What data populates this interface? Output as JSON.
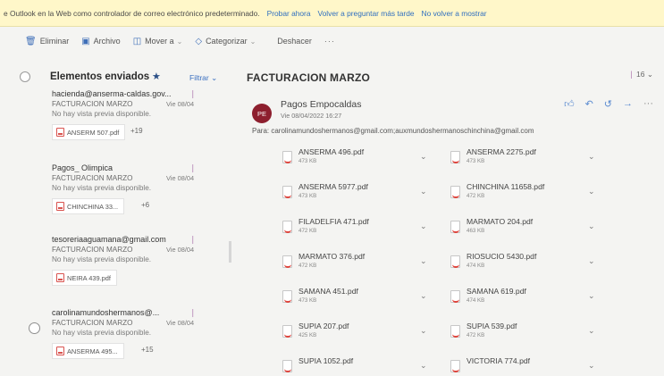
{
  "banner": {
    "message": "e Outlook en la Web como controlador de correo electrónico predeterminado.",
    "links": [
      "Probar ahora",
      "Volver a preguntar más tarde",
      "No volver a mostrar"
    ]
  },
  "toolbar": {
    "delete": "Eliminar",
    "archive": "Archivo",
    "move": "Mover a",
    "categorize": "Categorizar",
    "undo": "Deshacer",
    "more": "···"
  },
  "list": {
    "folder": "Elementos enviados",
    "filter": "Filtrar",
    "items": [
      {
        "from": "hacienda@anserma-caldas.gov...",
        "subject": "FACTURACION MARZO",
        "date": "Vie 08/04",
        "preview": "No hay vista previa disponible.",
        "attachment": "ANSERM 507.pdf",
        "more": "+19"
      },
      {
        "from": "Pagos_ Olimpica",
        "subject": "FACTURACION MARZO",
        "date": "Vie 08/04",
        "preview": "No hay vista previa disponible.",
        "attachment": "CHINCHINA 33...",
        "more": "+6"
      },
      {
        "from": "tesoreriaaguamana@gmail.com",
        "subject": "FACTURACION MARZO",
        "date": "Vie 08/04",
        "preview": "No hay vista previa disponible.",
        "attachment": "NEIRA 439.pdf",
        "more": ""
      },
      {
        "from": "carolinamundoshermanos@...",
        "subject": "FACTURACION MARZO",
        "date": "Vie 08/04",
        "preview": "No hay vista previa disponible.",
        "attachment": "ANSERMA 495...",
        "more": "+15"
      }
    ]
  },
  "reading": {
    "title": "FACTURACION MARZO",
    "count": "16",
    "avatar": "PE",
    "sender": "Pagos Empocaldas",
    "date": "Vie 08/04/2022 16:27",
    "recipients": "Para: carolinamundoshermanos@gmail.com;auxmundoshermanoschinchina@gmail.com",
    "files": [
      {
        "name": "ANSERMA 496.pdf",
        "size": "473 KB"
      },
      {
        "name": "ANSERMA 2275.pdf",
        "size": "473 KB"
      },
      {
        "name": "ANSERMA 5977.pdf",
        "size": "473 KB"
      },
      {
        "name": "CHINCHINA 11658.pdf",
        "size": "472 KB"
      },
      {
        "name": "FILADELFIA 471.pdf",
        "size": "472 KB"
      },
      {
        "name": "MARMATO 204.pdf",
        "size": "463 KB"
      },
      {
        "name": "MARMATO 376.pdf",
        "size": "472 KB"
      },
      {
        "name": "RIOSUCIO 5430.pdf",
        "size": "474 KB"
      },
      {
        "name": "SAMANA 451.pdf",
        "size": "473 KB"
      },
      {
        "name": "SAMANA 619.pdf",
        "size": "474 KB"
      },
      {
        "name": "SUPIA 207.pdf",
        "size": "425 KB"
      },
      {
        "name": "SUPIA 539.pdf",
        "size": "472 KB"
      },
      {
        "name": "SUPIA 1052.pdf",
        "size": ""
      },
      {
        "name": "VICTORIA 774.pdf",
        "size": ""
      }
    ]
  },
  "colors": {
    "banner_bg": "#fff7c9",
    "link": "#2f6fbf",
    "avatar_bg": "#8d1f2e",
    "pdf_red": "#e0433b"
  }
}
